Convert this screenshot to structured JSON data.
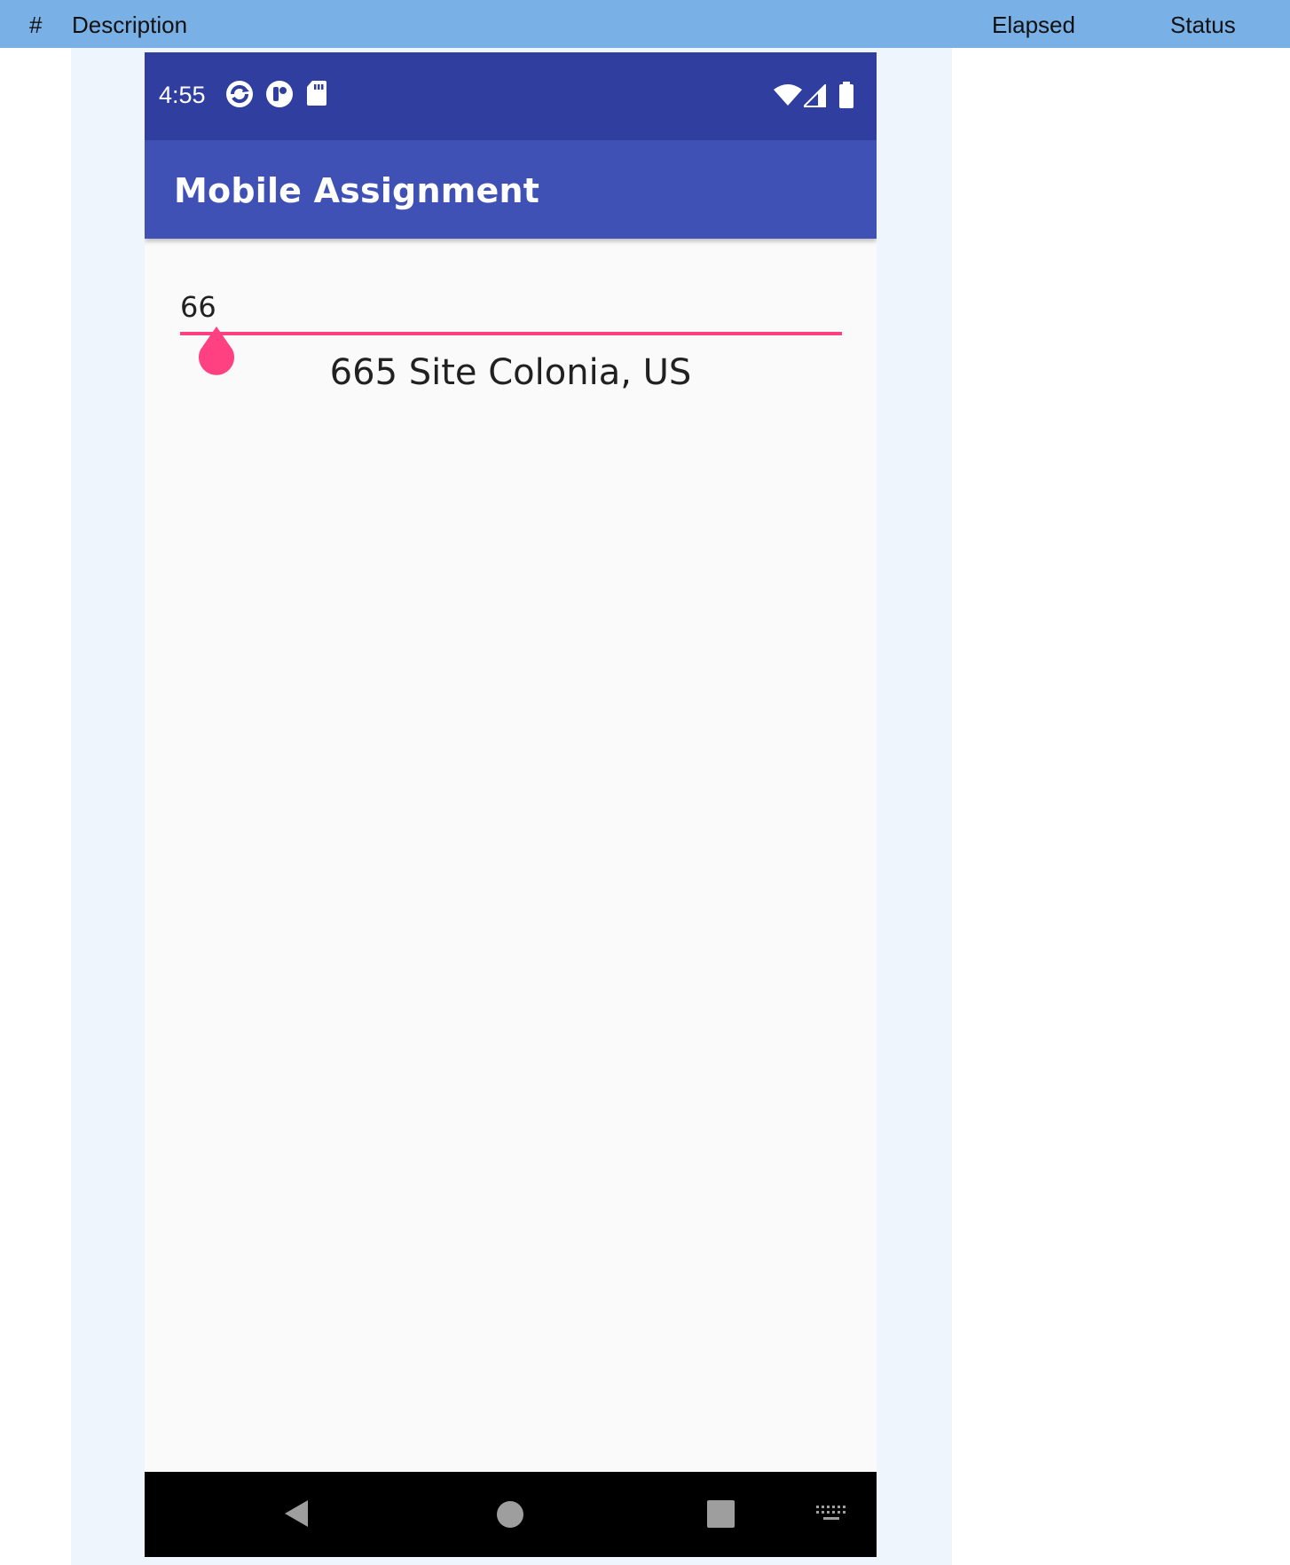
{
  "table_header": {
    "hash": "#",
    "description": "Description",
    "elapsed": "Elapsed",
    "status": "Status"
  },
  "device": {
    "status_bar": {
      "time": "4:55",
      "icons": [
        "sync-icon",
        "app-notification-icon",
        "sd-card-icon",
        "wifi-icon",
        "cell-signal-icon",
        "battery-icon"
      ]
    },
    "app_bar": {
      "title": "Mobile Assignment"
    },
    "seekbar": {
      "value_label": "66",
      "accent_color": "#ff4081"
    },
    "address_text": "665 Site Colonia, US",
    "nav_bar": {
      "buttons": [
        "back-icon",
        "home-icon",
        "recents-icon",
        "keyboard-icon"
      ]
    },
    "colors": {
      "status_bar": "#303f9f",
      "app_bar": "#3f51b5",
      "header_row": "#79b1e6"
    }
  }
}
